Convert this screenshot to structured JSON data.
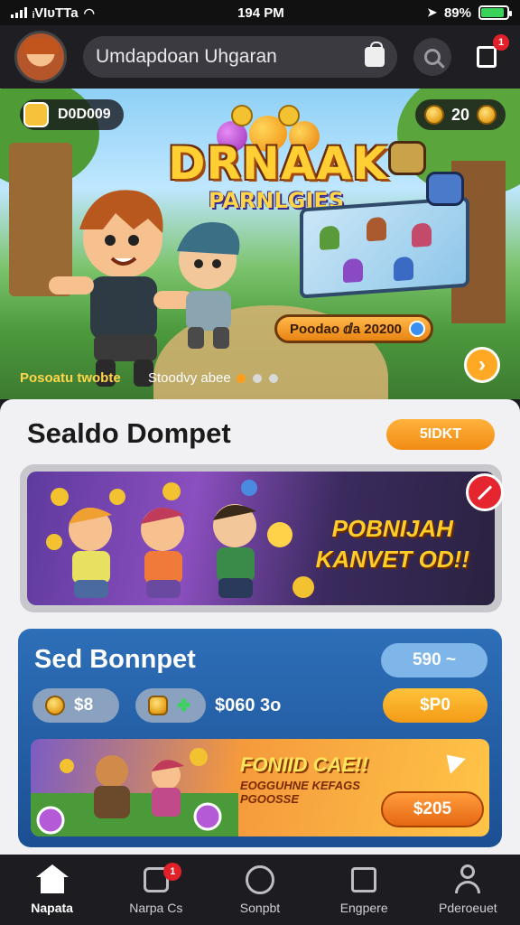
{
  "status_bar": {
    "carrier": "ᵢVIᴜTTa",
    "time": "194 PM",
    "battery": "89%",
    "battery_level": 0.89
  },
  "header": {
    "search_text": "Umdapdoan Uhgaran",
    "notification_count": "1"
  },
  "hero": {
    "chip_label": "D0D009",
    "coins": "20",
    "title": "DRNAAK",
    "subtitle": "PARNLGIES",
    "pill_label": "Poodao ⅆa 20200",
    "caption_left": "Posoatu twobte",
    "caption_right": "Stoodvy abee"
  },
  "section": {
    "title": "Sealdo Dompet",
    "button": "5IDKT",
    "banner1_text_line1": "POBNIJAH",
    "banner1_text_line2": "KANVET OD!!"
  },
  "card": {
    "title": "Sed Bonnpet",
    "pill_top": "590 ~",
    "coin_pill": "$8",
    "gem_value": "$060 3o",
    "orange_pill": "$P0",
    "banner2_title": "FONIID CAE!!",
    "banner2_sub_line1": "EOGGUHNE KEFAGS",
    "banner2_sub_line2": "PGOOSSE",
    "banner2_button": "$205"
  },
  "nav": {
    "items": [
      {
        "label": "Napata",
        "icon": "home-icon"
      },
      {
        "label": "Narpa Cs",
        "icon": "tasks-icon",
        "badge": "1"
      },
      {
        "label": "Sonpbt",
        "icon": "support-icon"
      },
      {
        "label": "Engpere",
        "icon": "upload-icon"
      },
      {
        "label": "Pderoeuet",
        "icon": "profile-icon"
      }
    ]
  }
}
